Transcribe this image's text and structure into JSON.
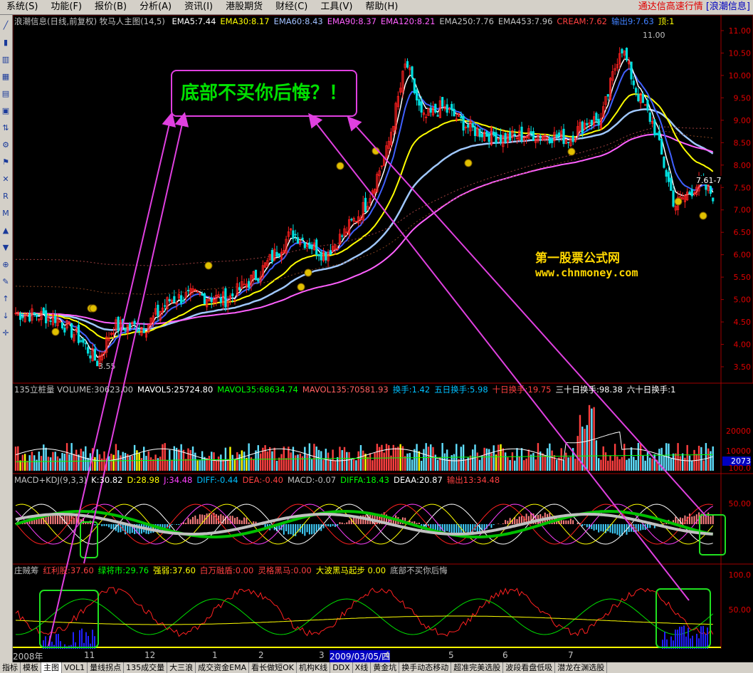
{
  "menu": {
    "items": [
      "系统(S)",
      "功能(F)",
      "报价(B)",
      "分析(A)",
      "资讯(I)",
      "港股期货",
      "财经(C)",
      "工具(V)",
      "帮助(H)"
    ],
    "right_text": "通达信高速行情",
    "right_link": "[浪潮信息]"
  },
  "main_header": {
    "title": "浪潮信息(日线,前复权) 牧马人主图(14,5)",
    "items": [
      {
        "text": "EMA5:7.44",
        "color": "#ffffff"
      },
      {
        "text": "EMA30:8.17",
        "color": "#ffff00"
      },
      {
        "text": "EMA60:8.43",
        "color": "#a0c0ff"
      },
      {
        "text": "EMA90:8.37",
        "color": "#ff60ff"
      },
      {
        "text": "EMA120:8.21",
        "color": "#ff60ff"
      },
      {
        "text": "EMA250:7.76",
        "color": "#c0c0c0"
      },
      {
        "text": "EMA453:7.96",
        "color": "#c0c0c0"
      },
      {
        "text": "CREAM:7.62",
        "color": "#ff4040"
      },
      {
        "text": "输出9:7.63",
        "color": "#4080ff"
      },
      {
        "text": "顶:1",
        "color": "#ffff00"
      }
    ]
  },
  "price_axis": [
    "11.00",
    "10.50",
    "10.00",
    "9.50",
    "9.00",
    "8.50",
    "8.00",
    "7.50",
    "7.00",
    "6.50",
    "6.00",
    "5.50",
    "5.00",
    "4.50",
    "4.00",
    "3.50"
  ],
  "price_annotations": {
    "high": "11.00",
    "low": "3.55",
    "last": "7.61-7"
  },
  "volume_header": {
    "items": [
      {
        "text": "135立桩量 VOLUME:30623.00",
        "color": "#c0c0c0"
      },
      {
        "text": "MAVOL5:25724.80",
        "color": "#ffffff"
      },
      {
        "text": "MAVOL35:68634.74",
        "color": "#00ff00"
      },
      {
        "text": "MAVOL135:70581.93",
        "color": "#ff6060"
      },
      {
        "text": "换手:1.42",
        "color": "#00c0ff"
      },
      {
        "text": "五日换手:5.98",
        "color": "#00c0ff"
      },
      {
        "text": "十日换手:19.75",
        "color": "#ff4040"
      },
      {
        "text": "三十日换手:98.38",
        "color": "#ffffff"
      },
      {
        "text": "六十日换手:1",
        "color": "#ffffff"
      }
    ]
  },
  "volume_axis": [
    "20000",
    "10000"
  ],
  "volume_last": "2073",
  "macd_header": {
    "items": [
      {
        "text": "MACD+KDJ(9,3,3)",
        "color": "#c0c0c0"
      },
      {
        "text": "K:30.82",
        "color": "#ffffff"
      },
      {
        "text": "D:28.98",
        "color": "#ffff00"
      },
      {
        "text": "J:34.48",
        "color": "#ff40ff"
      },
      {
        "text": "DIFF:-0.44",
        "color": "#00c0ff"
      },
      {
        "text": "DEA:-0.40",
        "color": "#ff4040"
      },
      {
        "text": "MACD:-0.07",
        "color": "#c0c0c0"
      },
      {
        "text": "DIFFA:18.43",
        "color": "#00ff00"
      },
      {
        "text": "DEAA:20.87",
        "color": "#ffffff"
      },
      {
        "text": "输出13:34.48",
        "color": "#ff4040"
      }
    ]
  },
  "macd_axis": [
    "100.0",
    "50.00"
  ],
  "chip_header": {
    "items": [
      {
        "text": "庄贼筹",
        "color": "#c0c0c0"
      },
      {
        "text": "红利股:37.60",
        "color": "#ff4040"
      },
      {
        "text": "绿将市:29.76",
        "color": "#00ff00"
      },
      {
        "text": "强弱:37.60",
        "color": "#ffff00"
      },
      {
        "text": "白万融盾:0.00",
        "color": "#ff4040"
      },
      {
        "text": "灵格黑马:0.00",
        "color": "#ff4040"
      },
      {
        "text": "大波黑马起步 0.00",
        "color": "#ffff00"
      },
      {
        "text": "底部不买你后悔",
        "color": "#c0c0c0"
      }
    ]
  },
  "chip_axis": [
    "100.0",
    "50.00"
  ],
  "dates": [
    "2008年",
    "11",
    "12",
    "1",
    "2",
    "3",
    "2009/03/05/四",
    "4",
    "5",
    "6",
    "7"
  ],
  "callout": "底部不买你后悔？！",
  "watermark": {
    "name": "第一股票公式网",
    "url": "www.chnmoney.com"
  },
  "bottom_tabs": [
    "指标",
    "模板",
    "主图",
    "VOL1",
    "量线拐点",
    "135成交量",
    "大三浪",
    "成交资金EMA",
    "看长做短OK",
    "机构K线",
    "DDX",
    "X线",
    "黄金坑",
    "换手动态移动",
    "超准完美选股",
    "波段看盘低吸",
    "潜龙在渊选股"
  ],
  "toolbar_icons": [
    "chart-line-icon",
    "candle-icon",
    "bars-icon",
    "table-icon",
    "grid-icon",
    "window-icon",
    "sort-icon",
    "gear-icon",
    "flag-icon",
    "x-icon",
    "ri-icon",
    "ma-icon",
    "up-icon",
    "down-icon",
    "zoom-icon",
    "pencil-icon",
    "arrow-up-icon",
    "arrow-down-icon",
    "cross-icon"
  ],
  "colors": {
    "up": "#ff2020",
    "down": "#00e0e0",
    "callout_border": "#e040e0",
    "callout_text": "#00e000",
    "watermark": "#ffd700"
  }
}
